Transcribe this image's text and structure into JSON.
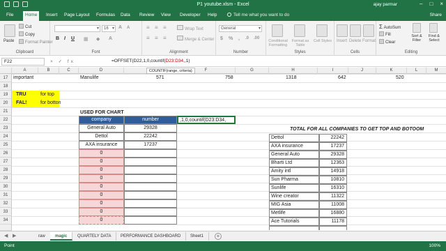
{
  "titlebar": {
    "title": "P1 youtube.xlsm - Excel",
    "user": "ajay parmar"
  },
  "tabs": [
    "File",
    "Home",
    "Insert",
    "Page Layout",
    "Formulas",
    "Data",
    "Review",
    "View",
    "Developer",
    "Help"
  ],
  "tell_me": "Tell me what you want to do",
  "share": "Share",
  "ribbon": {
    "clipboard": {
      "name": "Clipboard",
      "paste": "Paste",
      "cut": "Cut",
      "copy": "Copy",
      "format_painter": "Format Painter"
    },
    "font": {
      "name": "Font",
      "font_value": "",
      "size_value": "16"
    },
    "alignment": {
      "name": "Alignment",
      "wrap_text": "Wrap Text",
      "merge_center": "Merge & Center"
    },
    "number": {
      "name": "Number",
      "format_value": "General"
    },
    "styles": {
      "name": "Styles",
      "conditional": "Conditional Formatting",
      "format_table": "Format as Table",
      "cell_styles": "Cell Styles"
    },
    "cells": {
      "name": "Cells",
      "insert": "Insert",
      "delete": "Delete",
      "format": "Format"
    },
    "editing": {
      "name": "Editing",
      "autosum": "AutoSum",
      "fill": "Fill",
      "clear": "Clear",
      "sort_filter": "Sort & Filter",
      "find_select": "Find & Select"
    }
  },
  "formula_bar": {
    "name_box": "F22",
    "fx": "× ✓ fx",
    "formula_pre": "=OFFSET(D22,1,0,countif(",
    "formula_ref": "D23:D34",
    "formula_post": ",,1)",
    "tooltip": "COUNTIF(range, criteria)"
  },
  "columns": [
    "A",
    "B",
    "C",
    "D",
    "E",
    "F",
    "G",
    "H",
    "I",
    "J",
    "K",
    "L",
    "M",
    "N"
  ],
  "rows": [
    "17",
    "18",
    "19",
    "20",
    "21",
    "22",
    "23",
    "24",
    "25",
    "26",
    "27",
    "28",
    "29",
    "30",
    "31",
    "32",
    "33",
    "34"
  ],
  "row17": {
    "a": "important",
    "c": "Manulife",
    "e": "571",
    "f": "758",
    "g": "1318",
    "h": "642",
    "j": "520"
  },
  "toggles": [
    {
      "value": "TRUE",
      "label": "for top"
    },
    {
      "value": "FALSE",
      "label": "for botton"
    }
  ],
  "used_for_chart": "USED FOR CHART",
  "chart_table": {
    "headers": [
      "company",
      "number"
    ],
    "rows": [
      [
        "General Auto",
        "29328"
      ],
      [
        "Dettol",
        "22242"
      ],
      [
        "AXA insurance",
        "17237"
      ],
      [
        "0",
        ""
      ],
      [
        "0",
        ""
      ],
      [
        "0",
        ""
      ],
      [
        "0",
        ""
      ],
      [
        "0",
        ""
      ],
      [
        "0",
        ""
      ],
      [
        "0",
        ""
      ],
      [
        "0",
        ""
      ],
      [
        "0",
        ""
      ]
    ]
  },
  "editing_cell": ",1,0,countif(D23:D34,",
  "totals": {
    "title": "TOTAL FOR ALL COMPANIES TO GET TOP AND BOTOOM",
    "rows": [
      [
        "Dettol",
        "22242"
      ],
      [
        "AXA insurance",
        "17237"
      ],
      [
        "General Auto",
        "29328"
      ],
      [
        "Bharti Ltd",
        "12363"
      ],
      [
        "Amity intl",
        "14918"
      ],
      [
        "Sun Pharma",
        "10810"
      ],
      [
        "Sunlife",
        "16310"
      ],
      [
        "Wine creator",
        "11322"
      ],
      [
        "MIG Asia",
        "11008"
      ],
      [
        "Metlife",
        "16880"
      ],
      [
        "Ace Tutorials",
        "11178"
      ]
    ]
  },
  "sheets": [
    "raw",
    "magic",
    "QUARTELY DATA",
    "PERFORMANCE DASHBOARD",
    "Sheet1"
  ],
  "status": {
    "mode": "Point",
    "zoom": "100%"
  },
  "colors": {
    "excel_green": "#217346",
    "header_blue": "#2f5d9a",
    "toggle_yellow": "#ffff00",
    "pink_fill": "#f6d6d6"
  }
}
